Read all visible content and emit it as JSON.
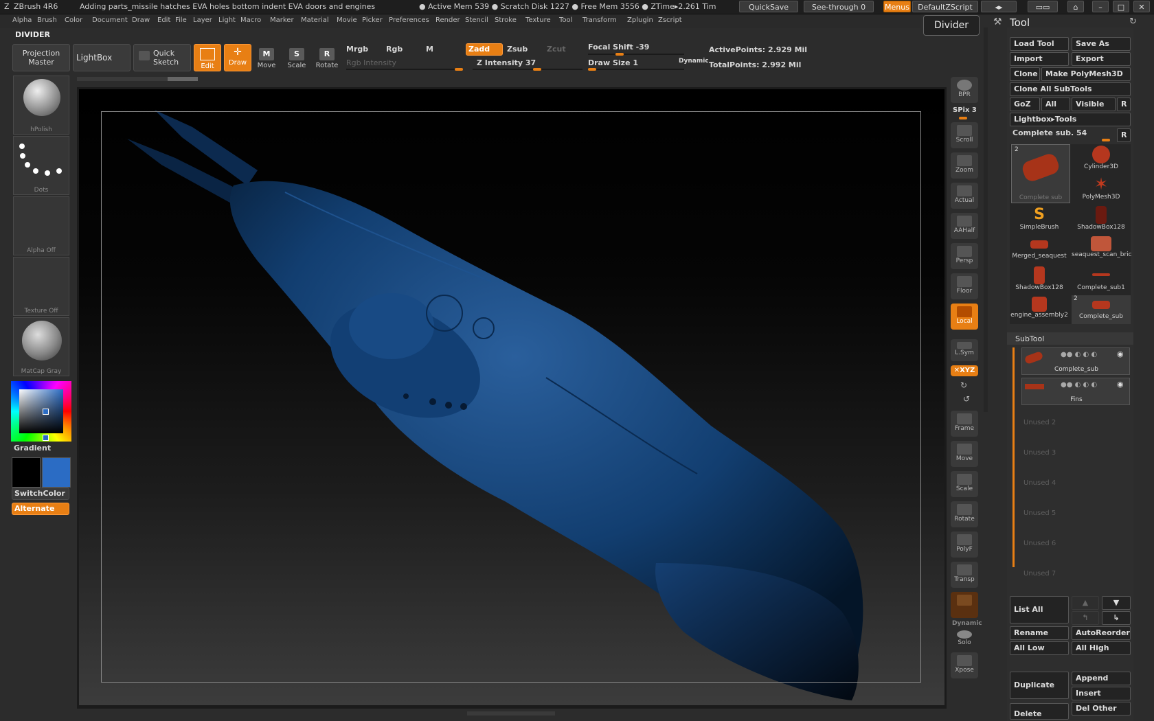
{
  "titlebar": {
    "app": "ZBrush 4R6",
    "doc": "Adding parts_missile hatches EVA holes bottom indent EVA doors and engines",
    "stats": "● Active Mem 539  ● Scratch Disk 1227  ● Free Mem 3556  ● ZTime▸2.261  Tim",
    "quicksave": "QuickSave",
    "seethrough": "See-through  0",
    "menus": "Menus",
    "script": "DefaultZScript"
  },
  "menubar": [
    "Alpha",
    "Brush",
    "Color",
    "Document",
    "Draw",
    "Edit",
    "File",
    "Layer",
    "Light",
    "Macro",
    "Marker",
    "Material",
    "Movie",
    "Picker",
    "Preferences",
    "Render",
    "Stencil",
    "Stroke",
    "Texture",
    "Tool",
    "Transform",
    "Zplugin",
    "Zscript"
  ],
  "divider": {
    "label": "DIVIDER",
    "tooltip": "Divider"
  },
  "shelf": {
    "projection_master": "Projection Master",
    "lightbox": "LightBox",
    "quick_sketch": "Quick Sketch",
    "edit": "Edit",
    "draw": "Draw",
    "move": "Move",
    "scale": "Scale",
    "rotate": "Rotate",
    "mrgb": "Mrgb",
    "rgb": "Rgb",
    "m": "M",
    "rgb_intensity": "Rgb Intensity",
    "zadd": "Zadd",
    "zsub": "Zsub",
    "zcut": "Zcut",
    "z_intensity": "Z Intensity 37",
    "focal_shift": "Focal Shift -39",
    "draw_size": "Draw Size 1",
    "dynamic": "Dynamic",
    "active_points": "ActivePoints: 2.929  Mil",
    "total_points": "TotalPoints: 2.992  Mil"
  },
  "left_tray": {
    "brush": "hPolish",
    "stroke": "Dots",
    "alpha": "Alpha  Off",
    "texture": "Texture  Off",
    "material": "MatCap  Gray",
    "gradient": "Gradient",
    "switchcolor": "SwitchColor",
    "alternate": "Alternate",
    "colors": {
      "main": "#2b6cc4",
      "secondary": "#000000",
      "accent": "#e87f14"
    }
  },
  "right_shelf": [
    {
      "id": "bpr",
      "label": "BPR"
    },
    {
      "id": "spix",
      "label": "SPix 3"
    },
    {
      "id": "scroll",
      "label": "Scroll"
    },
    {
      "id": "zoom",
      "label": "Zoom"
    },
    {
      "id": "actual",
      "label": "Actual"
    },
    {
      "id": "aahalf",
      "label": "AAHalf"
    },
    {
      "id": "persp",
      "label": "Persp"
    },
    {
      "id": "floor",
      "label": "Floor"
    },
    {
      "id": "local",
      "label": "Local"
    },
    {
      "id": "lsym",
      "label": "L.Sym"
    },
    {
      "id": "xyz",
      "label": "✕XYZ"
    },
    {
      "id": "frame",
      "label": "Frame"
    },
    {
      "id": "move",
      "label": "Move"
    },
    {
      "id": "scale",
      "label": "Scale"
    },
    {
      "id": "rotate",
      "label": "Rotate"
    },
    {
      "id": "polyf",
      "label": "PolyF"
    },
    {
      "id": "transp",
      "label": "Transp"
    },
    {
      "id": "dynamic",
      "label": "Dynamic"
    },
    {
      "id": "solo",
      "label": "Solo"
    },
    {
      "id": "xpose",
      "label": "Xpose"
    }
  ],
  "tool_panel": {
    "title": "Tool",
    "load_tool": "Load Tool",
    "save_as": "Save As",
    "import": "Import",
    "export": "Export",
    "clone": "Clone",
    "make_polymesh": "Make PolyMesh3D",
    "clone_all": "Clone All SubTools",
    "goz": "GoZ",
    "all": "All",
    "visible": "Visible",
    "r": "R",
    "lightbox_tools": "Lightbox▸Tools",
    "current_tool": "Complete sub. 54",
    "tools": [
      {
        "name": "Complete sub",
        "badge": "2"
      },
      {
        "name": "Cylinder3D"
      },
      {
        "name": "PolyMesh3D"
      },
      {
        "name": "SimpleBrush"
      },
      {
        "name": "ShadowBox128"
      },
      {
        "name": "Merged_seaquest"
      },
      {
        "name": "seaquest_scan_bric"
      },
      {
        "name": "ShadowBox128"
      },
      {
        "name": "Complete_sub1"
      },
      {
        "name": "engine_assembly2"
      },
      {
        "name": "Complete_sub",
        "badge": "2"
      }
    ],
    "subtool": {
      "header": "SubTool",
      "items": [
        "Complete_sub",
        "Fins"
      ],
      "unused": [
        "Unused 2",
        "Unused 3",
        "Unused 4",
        "Unused 5",
        "Unused 6",
        "Unused 7"
      ],
      "list_all": "List All",
      "rename": "Rename",
      "autoreorder": "AutoReorder",
      "all_low": "All Low",
      "all_high": "All High",
      "duplicate": "Duplicate",
      "append": "Append",
      "insert": "Insert",
      "delete": "Delete",
      "del_other": "Del Other"
    }
  }
}
